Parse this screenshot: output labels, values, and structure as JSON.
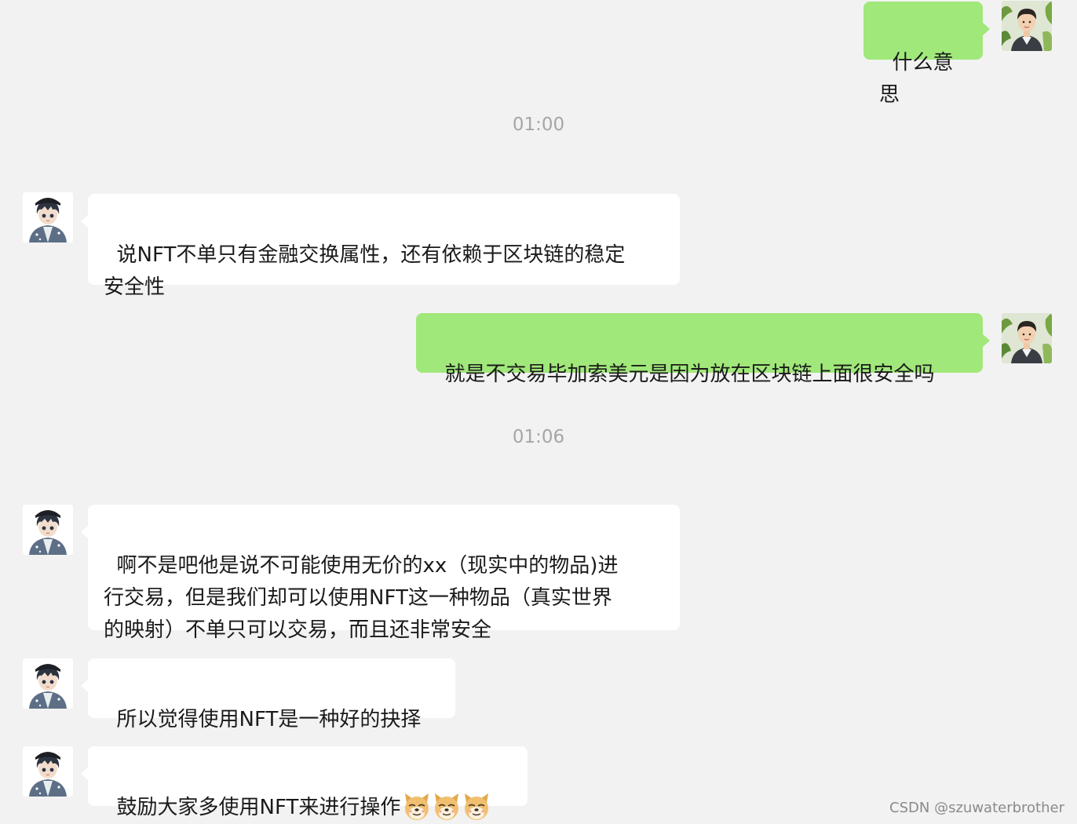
{
  "timestamps": [
    "01:00",
    "01:06"
  ],
  "messages": [
    {
      "side": "right",
      "text": "什么意思"
    },
    {
      "side": "left",
      "text": "说NFT不单只有金融交换属性，还有依赖于区块链的稳定\n安全性"
    },
    {
      "side": "right",
      "text": "就是不交易毕加索美元是因为放在区块链上面很安全吗"
    },
    {
      "side": "left",
      "text": "啊不是吧他是说不可能使用无价的xx（现实中的物品)进\n行交易，但是我们却可以使用NFT这一种物品（真实世界\n的映射）不单只可以交易，而且还非常安全"
    },
    {
      "side": "left",
      "text": "所以觉得使用NFT是一种好的抉择"
    },
    {
      "side": "left",
      "text": "鼓励大家多使用NFT来进行操作",
      "emoji": [
        "doge-emoji",
        "doge-emoji",
        "doge-emoji"
      ]
    }
  ],
  "watermark": "CSDN @szuwaterbrother",
  "colors": {
    "background": "#f2f2f2",
    "sent_bubble": "#a0e87a",
    "received_bubble": "#ffffff",
    "timestamp": "#a6a6a6"
  },
  "icons": {
    "self_avatar": "avatar-man-leaves",
    "other_avatar": "avatar-anime-boy-cap"
  }
}
